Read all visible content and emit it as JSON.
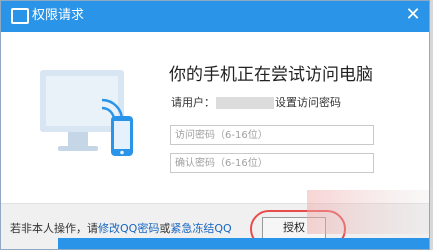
{
  "titlebar": {
    "title": "权限请求",
    "close_glyph": "✕",
    "accent": "#2a94e8"
  },
  "main": {
    "heading": "你的手机正在尝试访问电脑",
    "user_label": "请用户：",
    "user_suffix": "设置访问密码",
    "password_placeholder": "访问密码（6-16位）",
    "confirm_placeholder": "确认密码（6-16位）",
    "password_value": "",
    "confirm_value": ""
  },
  "footer": {
    "prefix": "若非本人操作，请",
    "link_modify": "修改QQ密码",
    "or": "或",
    "link_freeze": "紧急冻结QQ",
    "auth_button": "授权",
    "highlight_color": "#e74c4c"
  },
  "icons": {
    "app": "monitor-icon",
    "close": "close-icon",
    "illustration": "phone-computer-icon"
  }
}
